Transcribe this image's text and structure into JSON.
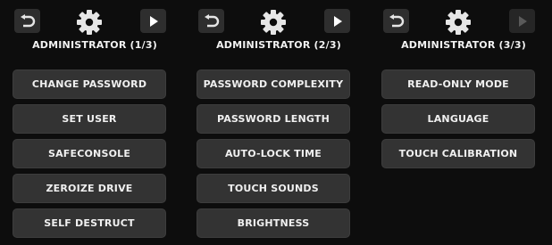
{
  "panels": [
    {
      "title": "ADMINISTRATOR (1/3)",
      "forward_enabled": true,
      "items": [
        "CHANGE PASSWORD",
        "SET USER",
        "SAFECONSOLE",
        "ZEROIZE DRIVE",
        "SELF DESTRUCT"
      ]
    },
    {
      "title": "ADMINISTRATOR (2/3)",
      "forward_enabled": true,
      "items": [
        "PASSWORD COMPLEXITY",
        "PASSWORD LENGTH",
        "AUTO-LOCK TIME",
        "TOUCH SOUNDS",
        "BRIGHTNESS"
      ]
    },
    {
      "title": "ADMINISTRATOR (3/3)",
      "forward_enabled": false,
      "items": [
        "READ-ONLY MODE",
        "LANGUAGE",
        "TOUCH CALIBRATION"
      ]
    }
  ],
  "icons": {
    "back": "back-arrow-icon",
    "settings": "gear-icon",
    "forward": "play-forward-icon"
  },
  "colors": {
    "background": "#0d0d0d",
    "button": "#333333",
    "icon": "#e6e6e6",
    "icon_disabled": "#5a5a5a",
    "text": "#f0f0f0"
  }
}
